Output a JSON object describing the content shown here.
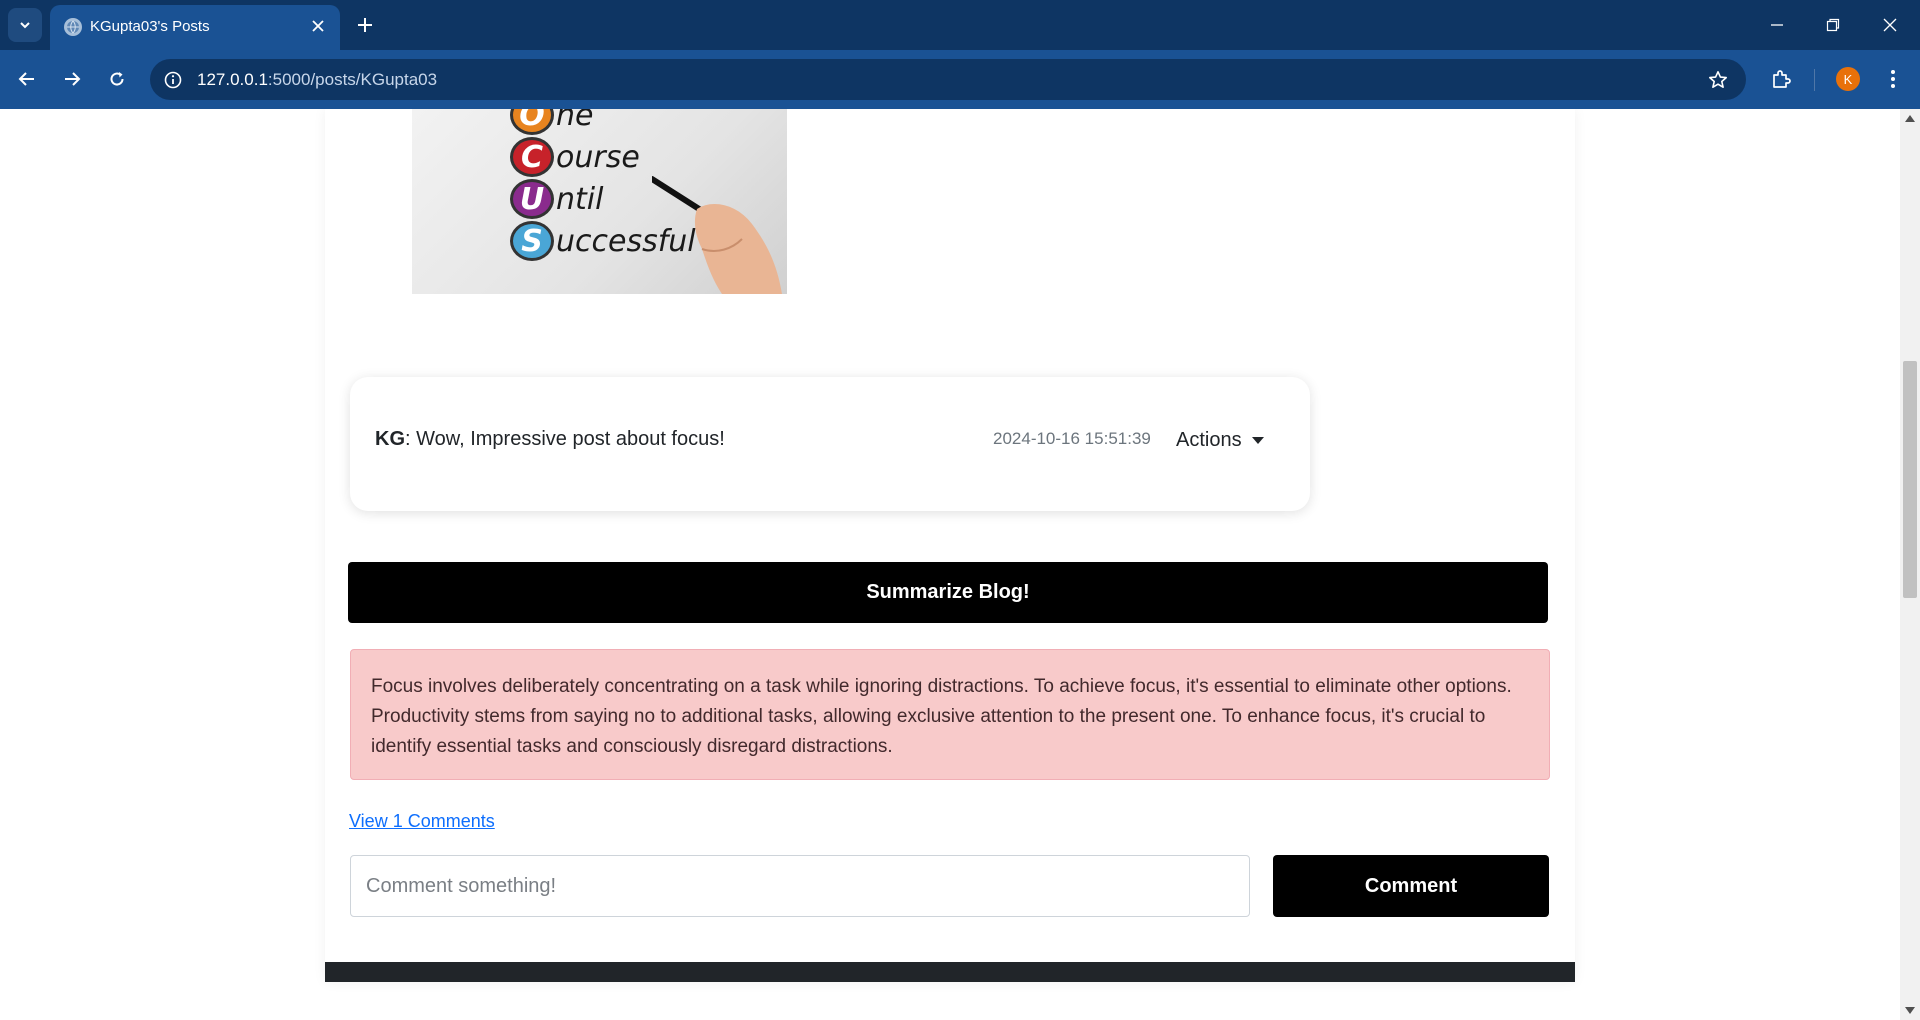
{
  "browser": {
    "tab_title": "KGupta03's Posts",
    "url_host": "127.0.0.1",
    "url_path": ":5000/posts/KGupta03",
    "profile_initial": "K"
  },
  "post": {
    "image": {
      "acronym": [
        {
          "letter": "O",
          "rest": "ne",
          "color": "#e8841f"
        },
        {
          "letter": "C",
          "rest": "ourse",
          "color": "#c7222a"
        },
        {
          "letter": "U",
          "rest": "ntil",
          "color": "#8a2b8d"
        },
        {
          "letter": "S",
          "rest": "uccessful",
          "color": "#4aa6d6"
        }
      ]
    },
    "comment": {
      "author": "KG",
      "separator": ": ",
      "text": "Wow, Impressive post about focus!",
      "timestamp": "2024-10-16 15:51:39",
      "actions_label": "Actions"
    },
    "summarize_label": "Summarize Blog!",
    "summary": "Focus involves deliberately concentrating on a task while ignoring distractions. To achieve focus, it's essential to eliminate other options. Productivity stems from saying no to additional tasks, allowing exclusive attention to the present one. To enhance focus, it's crucial to identify essential tasks and consciously disregard distractions.",
    "view_comments_label": "View 1 Comments",
    "comment_placeholder": "Comment something!",
    "comment_button_label": "Comment"
  },
  "colors": {
    "chrome_dark": "#0e3563",
    "chrome_active": "#1a5294",
    "summary_bg": "#f8caca",
    "link": "#0d6efd",
    "button_bg": "#000000"
  }
}
